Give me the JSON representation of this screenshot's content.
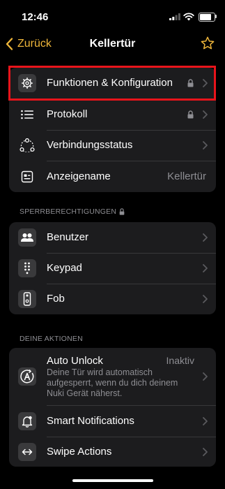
{
  "status": {
    "time": "12:46"
  },
  "nav": {
    "back_label": "Zurück",
    "title": "Kellertür"
  },
  "sections": {
    "sperr": "SPERRBERECHTIGUNGEN",
    "aktionen": "DEINE AKTIONEN"
  },
  "rows": {
    "funktionen": "Funktionen & Konfiguration",
    "protokoll": "Protokoll",
    "verbindung": "Verbindungsstatus",
    "anzeigename": "Anzeigename",
    "anzeigename_value": "Kellertür",
    "benutzer": "Benutzer",
    "keypad": "Keypad",
    "fob": "Fob",
    "autounlock": "Auto Unlock",
    "autounlock_value": "Inaktiv",
    "autounlock_desc": "Deine Tür wird automatisch aufgesperrt, wenn du dich deinem Nuki Gerät näherst.",
    "smart": "Smart Notifications",
    "swipe": "Swipe Actions"
  },
  "colors": {
    "accent": "#f0b73b",
    "highlight": "#e8141b",
    "card": "#1c1c1e"
  },
  "icons": [
    "gear-icon",
    "list-icon",
    "network-icon",
    "id-card-icon",
    "users-icon",
    "keypad-icon",
    "fob-icon",
    "auto-unlock-icon",
    "bell-icon",
    "swipe-icon",
    "lock-icon",
    "chevron-right-icon",
    "star-icon",
    "back-chevron-icon"
  ]
}
